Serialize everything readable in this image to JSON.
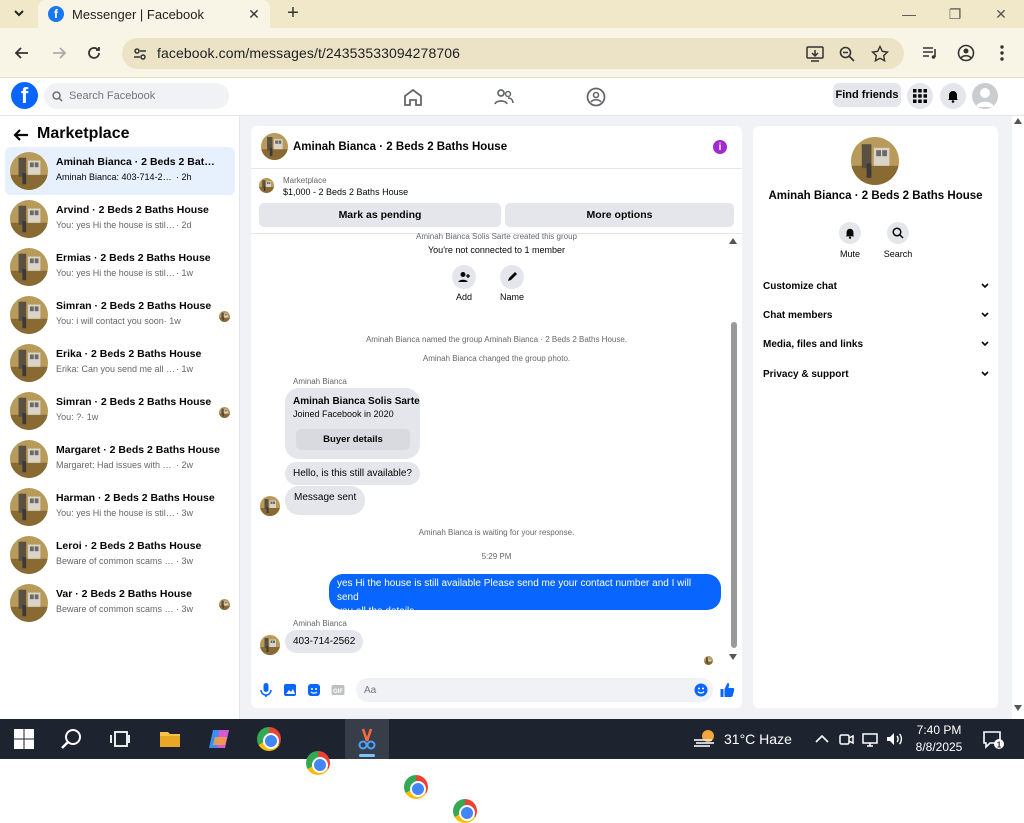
{
  "browser": {
    "tab_title": "Messenger | Facebook",
    "url": "facebook.com/messages/t/24353533094278706"
  },
  "fb": {
    "logo": "f",
    "search_placeholder": "Search Facebook",
    "find_friends": "Find friends"
  },
  "sidebar": {
    "title": "Marketplace",
    "conversations": [
      {
        "name": "Aminah Bianca · 2 Beds 2 Baths H...",
        "preview": "Aminah Bianca: 403-714-2562",
        "time": "· 2h"
      },
      {
        "name": "Arvind · 2 Beds 2 Baths House",
        "preview": "You: yes Hi the house is still available ...",
        "time": "· 2d"
      },
      {
        "name": "Ermias · 2 Beds 2 Baths House",
        "preview": "You: yes Hi the house is still available ...",
        "time": "· 1w"
      },
      {
        "name": "Simran · 2 Beds 2 Baths House",
        "preview": "You: i will contact you soon",
        "time": "· 1w"
      },
      {
        "name": "Erika · 2 Beds 2 Baths House",
        "preview": "Erika: Can you send me all the details,...",
        "time": "· 1w"
      },
      {
        "name": "Simran · 2 Beds 2 Baths House",
        "preview": "You: ?",
        "time": "· 1w"
      },
      {
        "name": "Margaret · 2 Beds 2 Baths House",
        "preview": "Margaret: Had issues with my phone j...",
        "time": "· 2w"
      },
      {
        "name": "Harman · 2 Beds 2 Baths House",
        "preview": "You: yes Hi the house is still available ...",
        "time": "· 3w"
      },
      {
        "name": "Leroi · 2 Beds 2 Baths House",
        "preview": "Beware of common scams using pay...",
        "time": "· 3w"
      },
      {
        "name": "Var · 2 Beds 2 Baths House",
        "preview": "Beware of common scams using p...",
        "time": "· 3w"
      }
    ]
  },
  "chat": {
    "title": "Aminah Bianca · 2 Beds 2 Baths House",
    "marketplace_label": "Marketplace",
    "listing": "$1,000 - 2 Beds 2 Baths House",
    "mark_pending": "Mark as pending",
    "more_options": "More options",
    "created_group": "Aminah Bianca Solis Sarte created this group",
    "not_connected": "You're not connected to 1 member",
    "add_label": "Add",
    "name_label": "Name",
    "named_group": "Aminah Bianca named the group Aminah Bianca · 2 Beds 2 Baths House.",
    "changed_photo": "Aminah Bianca changed the group photo.",
    "sender1": "Aminah Bianca",
    "buyer_name": "Aminah Bianca Solis Sarte",
    "buyer_joined": "Joined Facebook in 2020",
    "buyer_details": "Buyer details",
    "msg_available": "Hello, is this still available?",
    "msg_sent": "Message sent",
    "waiting": "Aminah Bianca is waiting for your response.",
    "time_stamp": "5:29 PM",
    "out_msg_line1": "yes Hi the house is still available Please send me your contact number and I will send",
    "out_msg_line2": "you all the details",
    "sender2": "Aminah Bianca",
    "phone_msg": "403-714-2562",
    "input_placeholder": "Aa"
  },
  "details": {
    "name": "Aminah Bianca · 2 Beds 2 Baths House",
    "mute": "Mute",
    "search": "Search",
    "rows": [
      "Customize chat",
      "Chat members",
      "Media, files and links",
      "Privacy & support"
    ]
  },
  "taskbar": {
    "weather": "31°C  Haze",
    "time": "7:40 PM",
    "date": "8/8/2025"
  },
  "colors": {
    "brand": "#0866ff",
    "info_purple": "#a22bd0",
    "active_row": "#e7f0fd"
  }
}
